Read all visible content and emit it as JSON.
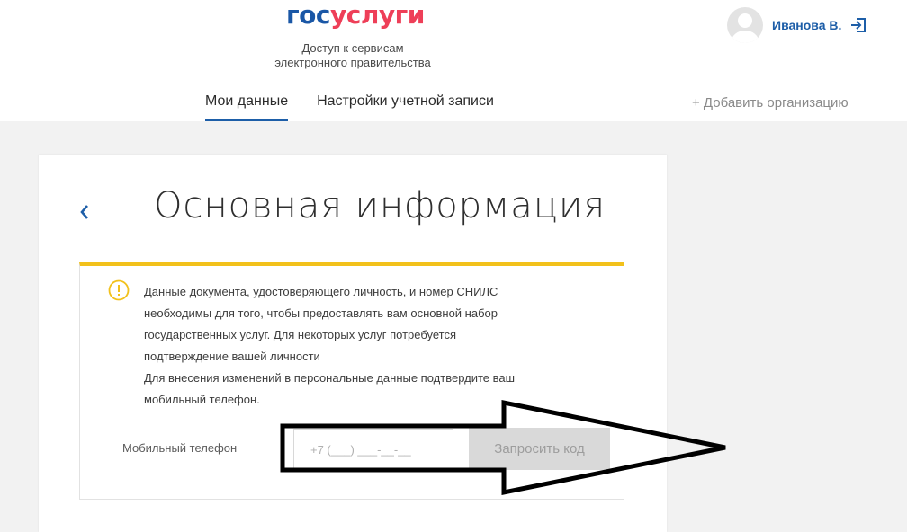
{
  "header": {
    "logo_part1": "гос",
    "logo_part2": "услуги",
    "tagline_line1": "Доступ к сервисам",
    "tagline_line2": "электронного правительства",
    "user_name": "Иванова В.",
    "tabs": [
      {
        "label": "Мои данные",
        "active": true
      },
      {
        "label": "Настройки учетной записи",
        "active": false
      }
    ],
    "add_org": "+ Добавить организацию"
  },
  "card": {
    "title": "Основная информация",
    "notice_lines": [
      "Данные документа, удостоверяющего личность, и номер СНИЛС",
      "необходимы для того, чтобы предоставлять вам основной набор",
      "государственных услуг. Для некоторых услуг потребуется",
      "подтверждение вашей личности",
      "Для внесения изменений в персональные данные подтвердите ваш",
      "мобильный телефон."
    ],
    "phone_label": "Мобильный телефон",
    "phone_placeholder": "+7 (___) ___-__-__",
    "request_code": "Запросить код"
  },
  "colors": {
    "brand_blue": "#1a57a6",
    "brand_red": "#ee3f58",
    "warning_yellow": "#f2c11b",
    "link_blue": "#1d5ea8"
  },
  "icons": [
    "user-avatar-icon",
    "logout-icon",
    "back-chevron-icon",
    "warning-icon",
    "arrow-annotation"
  ]
}
